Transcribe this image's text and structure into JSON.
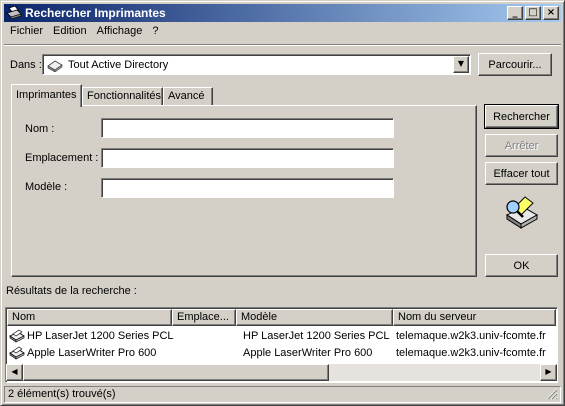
{
  "window": {
    "title": "Rechercher Imprimantes",
    "controls": {
      "minimize": "_",
      "maximize": "□",
      "close": "×"
    }
  },
  "menubar": {
    "items": [
      {
        "label": "Fichier",
        "mnemonic": "F"
      },
      {
        "label": "Edition",
        "mnemonic": "E"
      },
      {
        "label": "Affichage",
        "mnemonic": "A"
      },
      {
        "label": "?",
        "mnemonic": "?"
      }
    ]
  },
  "scope": {
    "label": "Dans :",
    "selected": "Tout Active Directory",
    "browse_button": "Parcourir..."
  },
  "tabs": [
    {
      "label": "Imprimantes",
      "active": true
    },
    {
      "label": "Fonctionnalités",
      "active": false
    },
    {
      "label": "Avancé",
      "active": false
    }
  ],
  "form": {
    "name_label": "Nom :",
    "name_value": "",
    "location_label": "Emplacement :",
    "location_value": "",
    "model_label": "Modèle :",
    "model_value": ""
  },
  "actions": {
    "search": "Rechercher",
    "stop": "Arrêter",
    "clear": "Effacer tout",
    "ok": "OK"
  },
  "results": {
    "label": "Résultats de la recherche :",
    "columns": [
      "Nom",
      "Emplace...",
      "Modèle",
      "Nom du serveur"
    ],
    "rows": [
      {
        "name": "HP LaserJet 1200 Series PCL",
        "location": "",
        "model": "HP LaserJet 1200 Series PCL",
        "server": "telemaque.w2k3.univ-fcomte.fr"
      },
      {
        "name": "Apple LaserWriter Pro 600",
        "location": "",
        "model": "Apple LaserWriter Pro 600",
        "server": "telemaque.w2k3.univ-fcomte.fr"
      }
    ]
  },
  "status": {
    "text": "2 élément(s) trouvé(s)"
  },
  "colors": {
    "face": "#d4d0c8",
    "title_gradient_start": "#0a246a",
    "title_gradient_end": "#a6caf0",
    "disabled_text": "#808080"
  }
}
